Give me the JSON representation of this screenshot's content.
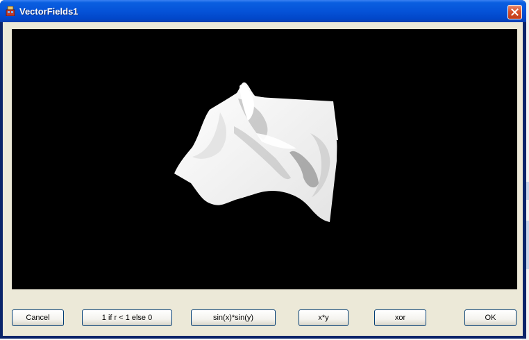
{
  "window": {
    "title": "VectorFields1",
    "icon": "app-icon",
    "close_icon": "close-icon"
  },
  "viewport": {
    "background": "#000000",
    "surface_color": "#ffffff"
  },
  "buttons": {
    "cancel": "Cancel",
    "preset_step": "1 if r < 1 else 0",
    "preset_sinsin": "sin(x)*sin(y)",
    "preset_xy": "x*y",
    "preset_xor": "xor",
    "ok": "OK"
  },
  "colors": {
    "titlebar": "#0553d8",
    "client_bg": "#ece9d8",
    "close_button": "#d5502b"
  }
}
